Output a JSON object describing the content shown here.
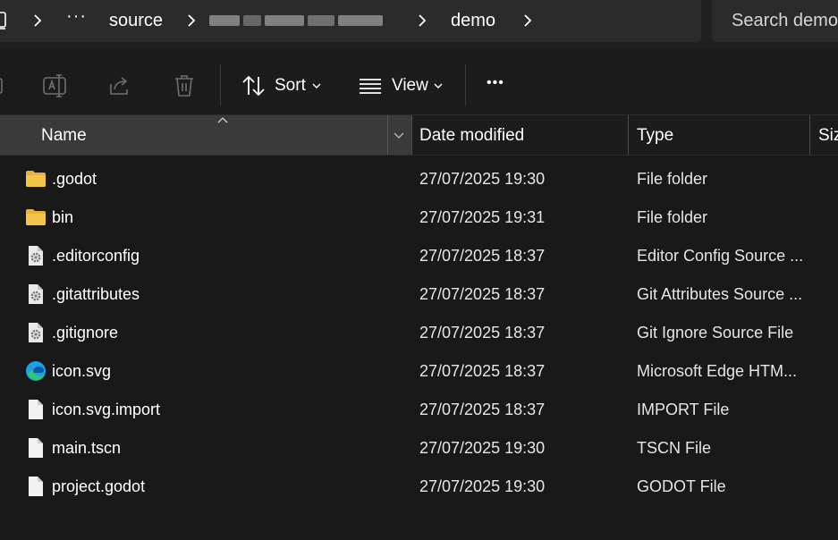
{
  "address": {
    "ellipsis": "···",
    "crumbs": [
      "source",
      "demo"
    ],
    "search_placeholder": "Search demo"
  },
  "commandbar": {
    "sort_label": "Sort",
    "view_label": "View",
    "more_label": "•••"
  },
  "columns": {
    "name": "Name",
    "date": "Date modified",
    "type": "Type",
    "size": "Size"
  },
  "colors": {
    "folder": "#f3c34a",
    "accent_edge": "#1aa0e6"
  },
  "files": [
    {
      "name": ".godot",
      "date": "27/07/2025 19:30",
      "type": "File folder",
      "icon": "folder-icon"
    },
    {
      "name": "bin",
      "date": "27/07/2025 19:31",
      "type": "File folder",
      "icon": "folder-icon"
    },
    {
      "name": ".editorconfig",
      "date": "27/07/2025 18:37",
      "type": "Editor Config Source ...",
      "icon": "config-file-icon"
    },
    {
      "name": ".gitattributes",
      "date": "27/07/2025 18:37",
      "type": "Git Attributes Source ...",
      "icon": "config-file-icon"
    },
    {
      "name": ".gitignore",
      "date": "27/07/2025 18:37",
      "type": "Git Ignore Source File",
      "icon": "config-file-icon"
    },
    {
      "name": "icon.svg",
      "date": "27/07/2025 18:37",
      "type": "Microsoft Edge HTM...",
      "icon": "edge-icon"
    },
    {
      "name": "icon.svg.import",
      "date": "27/07/2025 18:37",
      "type": "IMPORT File",
      "icon": "file-icon"
    },
    {
      "name": "main.tscn",
      "date": "27/07/2025 19:30",
      "type": "TSCN File",
      "icon": "file-icon"
    },
    {
      "name": "project.godot",
      "date": "27/07/2025 19:30",
      "type": "GODOT File",
      "icon": "file-icon"
    }
  ]
}
